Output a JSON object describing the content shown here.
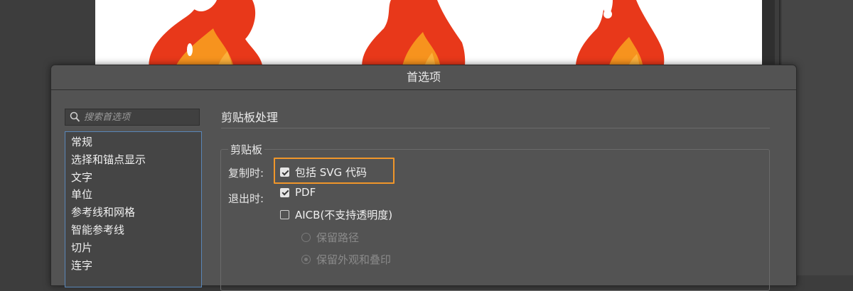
{
  "dialog": {
    "title": "首选项"
  },
  "search": {
    "placeholder": "搜索首选项",
    "icon": "search-icon"
  },
  "categories": [
    "常规",
    "选择和锚点显示",
    "文字",
    "单位",
    "参考线和网格",
    "智能参考线",
    "切片",
    "连字"
  ],
  "section": {
    "title": "剪贴板处理"
  },
  "clipboard_group": {
    "legend": "剪贴板",
    "copy_label": "复制时:",
    "exit_label": "退出时:",
    "options": {
      "include_svg": {
        "label": "包括 SVG 代码",
        "checked": true
      },
      "pdf": {
        "label": "PDF",
        "checked": true
      },
      "aicb": {
        "label": "AICB(不支持透明度)",
        "checked": false
      },
      "preserve_paths": {
        "label": "保留路径",
        "selected": false,
        "enabled": false
      },
      "preserve_appearance": {
        "label": "保留外观和叠印",
        "selected": true,
        "enabled": false
      }
    }
  },
  "colors": {
    "highlight": "#f0962a",
    "flame_outer": "#e8381a",
    "flame_inner": "#f7931e",
    "flame_core": "#fbb03b"
  }
}
